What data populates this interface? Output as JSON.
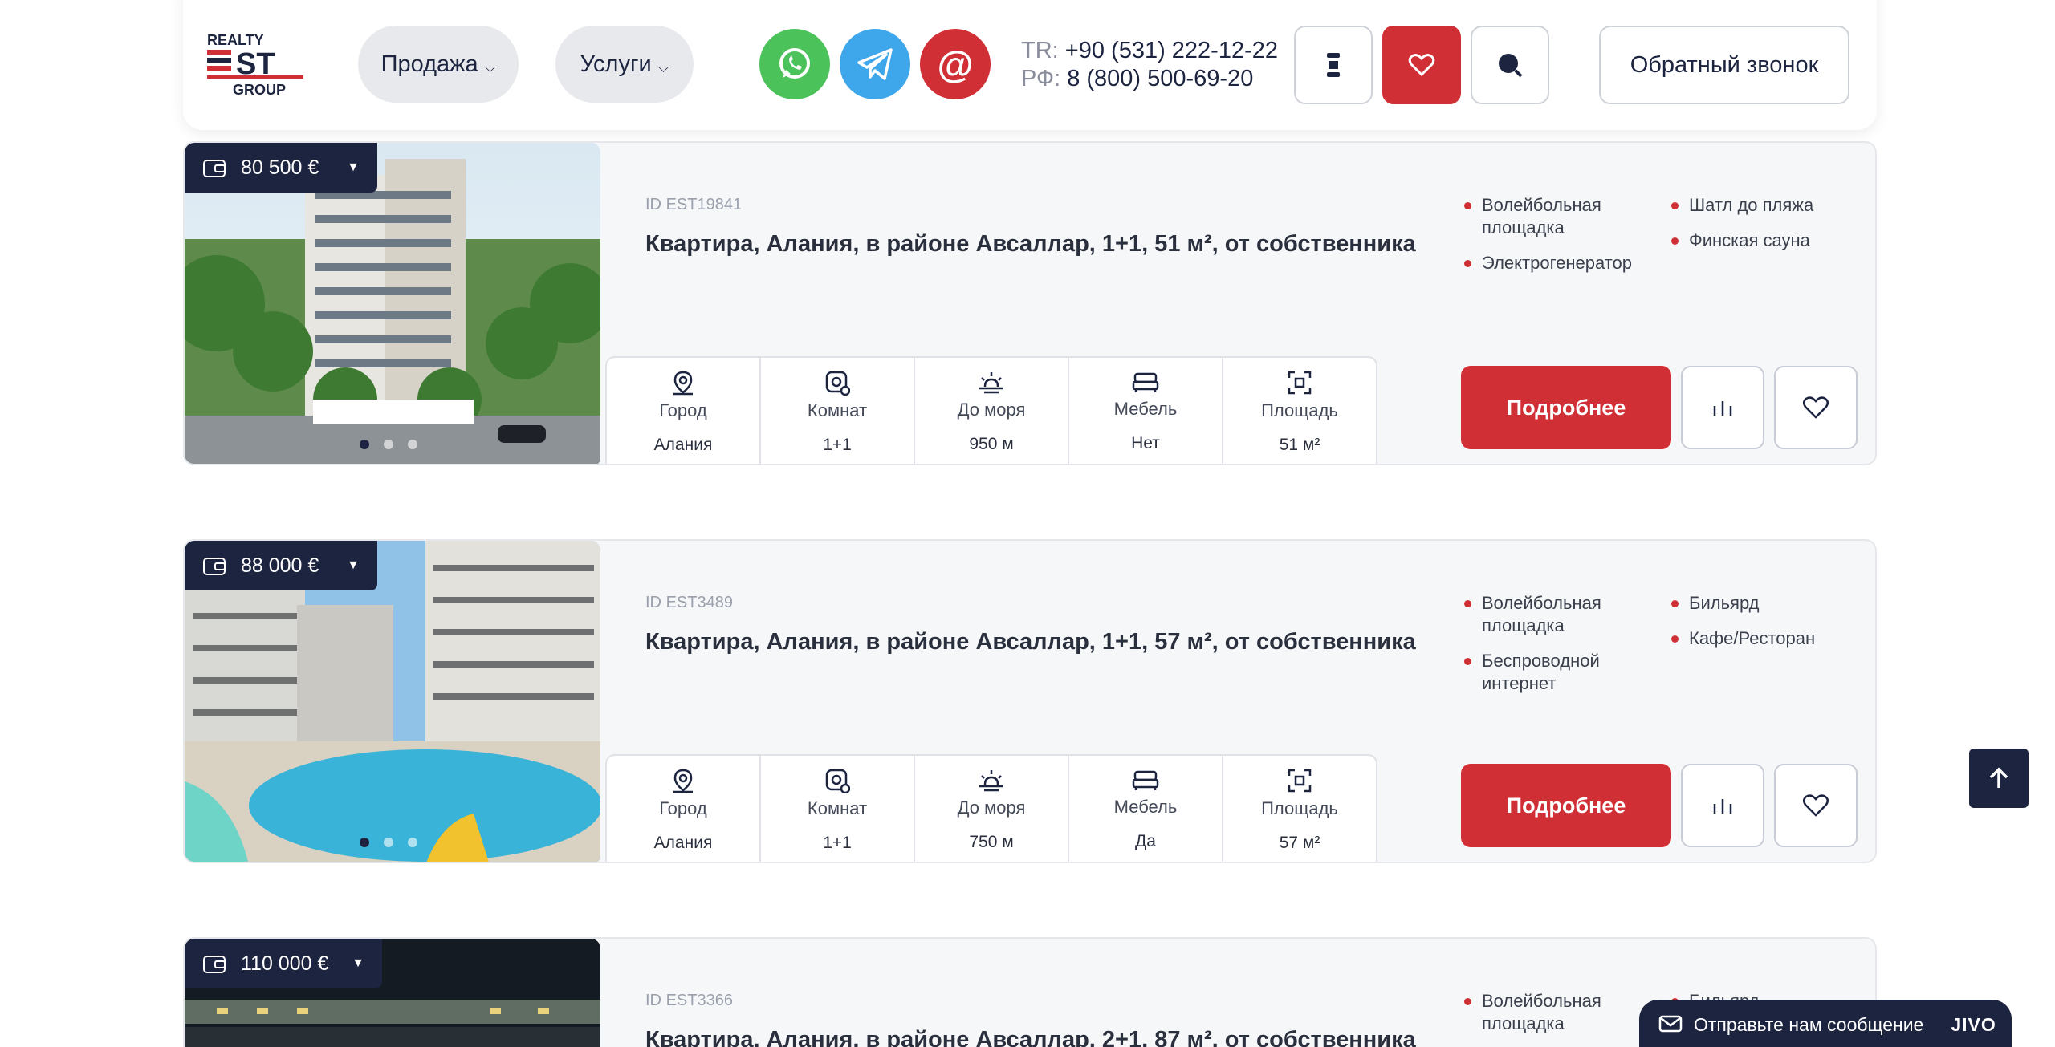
{
  "header": {
    "logo_text": [
      "REALTY",
      "EST",
      "GROUP"
    ],
    "menu": [
      {
        "label": "Продажа",
        "chevron": "⌵"
      },
      {
        "label": "Услуги",
        "chevron": "⌵"
      }
    ],
    "contact_icons": [
      "whatsapp-icon",
      "telegram-icon",
      "email-icon"
    ],
    "phones": [
      {
        "prefix": "TR:",
        "number": "+90 (531) 222-12-22"
      },
      {
        "prefix": "РФ:",
        "number": "8 (800) 500-69-20"
      }
    ],
    "callback_label": "Обратный звонок",
    "accent": "#d02f35",
    "navy": "#1c2440"
  },
  "spec_labels": [
    "Город",
    "Комнат",
    "До моря",
    "Мебель",
    "Площадь"
  ],
  "more_label": "Подробнее",
  "listings": [
    {
      "price": "80 500 €",
      "id_prefix": "ID",
      "id": "EST19841",
      "title": "Квартира, Алания, в районе Авсаллар, 1+1, 51 м², от собственника",
      "specs": [
        "Алания",
        "1+1",
        "950 м",
        "Нет",
        "51 м²"
      ],
      "features_col1": [
        "Волейбольная площадка",
        "Электрогенератор"
      ],
      "features_col2": [
        "Шатл до пляжа",
        "Финская сауна"
      ]
    },
    {
      "price": "88 000 €",
      "id_prefix": "ID",
      "id": "EST3489",
      "title": "Квартира, Алания, в районе Авсаллар, 1+1, 57 м², от собственника",
      "specs": [
        "Алания",
        "1+1",
        "750 м",
        "Да",
        "57 м²"
      ],
      "features_col1": [
        "Волейбольная площадка",
        "Беспроводной интернет"
      ],
      "features_col2": [
        "Бильярд",
        "Кафе/Ресторан"
      ]
    },
    {
      "price": "110 000 €",
      "id_prefix": "ID",
      "id": "EST3366",
      "title": "Квартира, Алания, в районе Авсаллар, 2+1, 87 м², от собственника",
      "features_col1": [
        "Волейбольная площадка"
      ],
      "features_col2": [
        "Бильярд"
      ]
    }
  ],
  "chat": {
    "label": "Отправьте нам сообщение",
    "brand": "JIVO"
  }
}
